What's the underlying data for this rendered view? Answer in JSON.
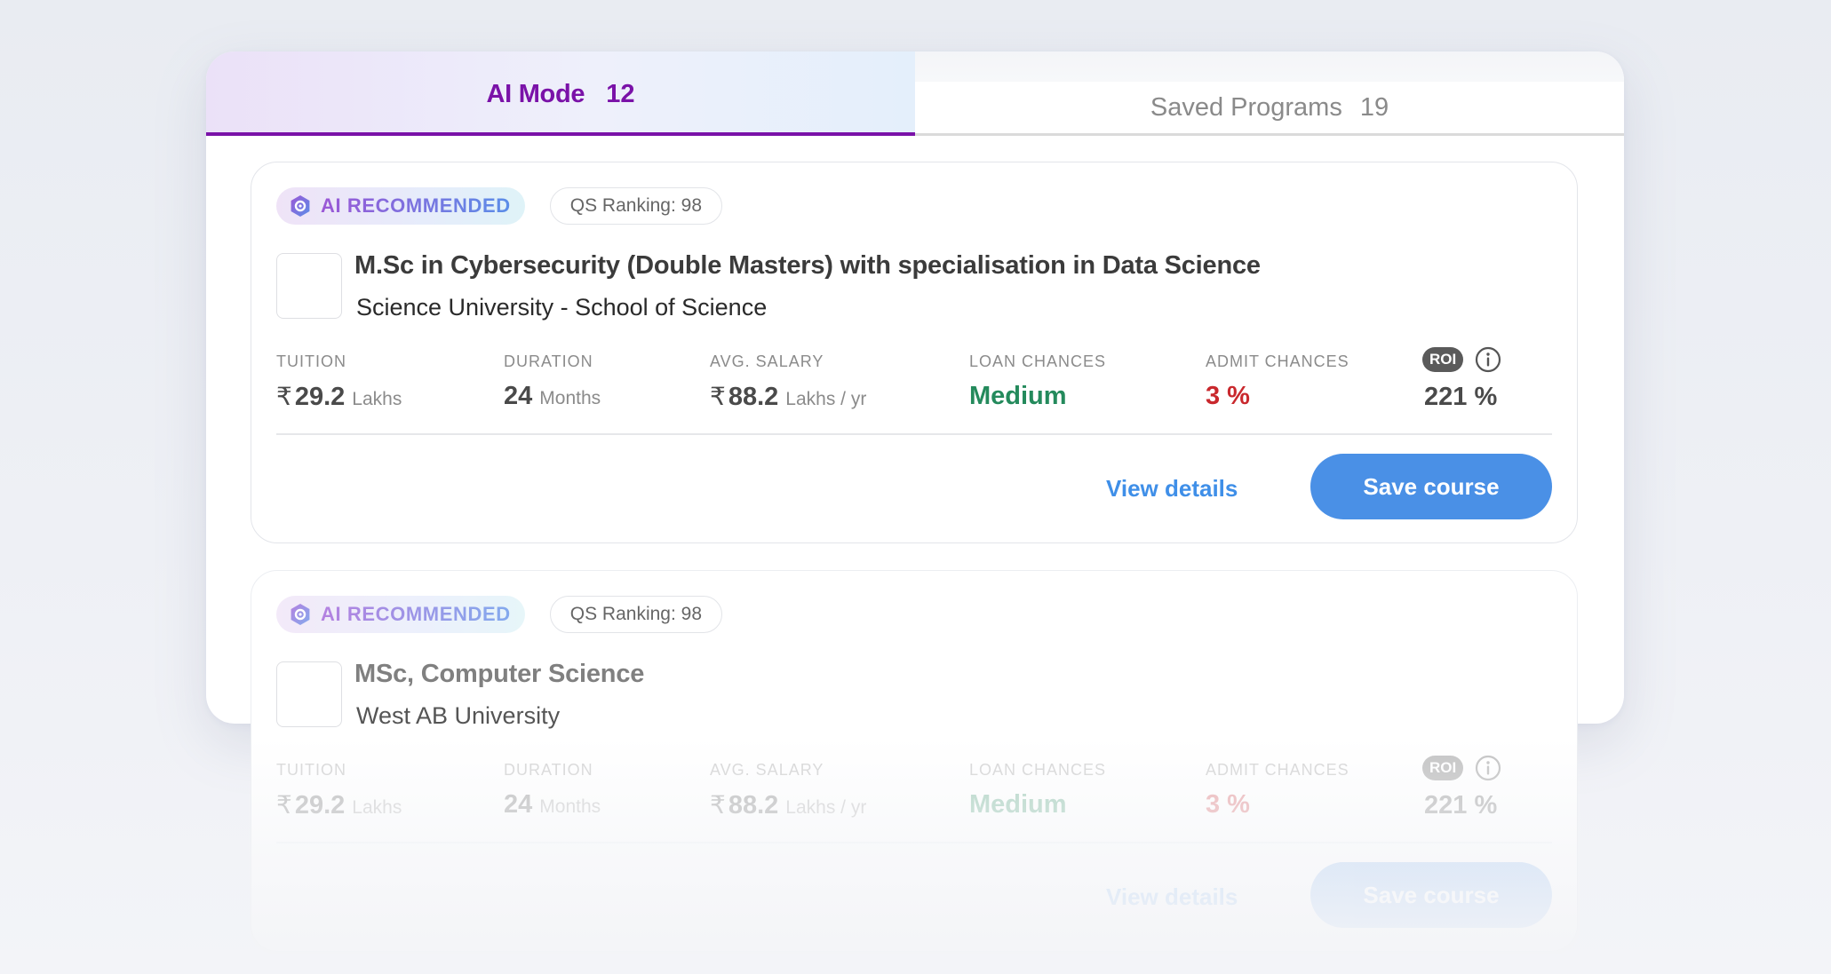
{
  "tabs": [
    {
      "label": "AI Mode",
      "count": "12"
    },
    {
      "label": "Saved Programs",
      "count": "19"
    }
  ],
  "colors": {
    "accent_purple": "#7a12a8",
    "link_blue": "#3f8fe8",
    "button_blue": "#4a90e6",
    "loan_green": "#248a5c",
    "admit_red": "#c9282d"
  },
  "icons": {
    "ai_badge": "ai-sparkle-hexagon-icon",
    "roi_info": "info-circle-icon"
  },
  "stat_labels": {
    "tuition": "TUITION",
    "duration": "DURATION",
    "salary": "AVG. SALARY",
    "loan": "LOAN CHANCES",
    "admit": "ADMIT CHANCES",
    "roi": "ROI"
  },
  "cards": [
    {
      "badge": "AI RECOMMENDED",
      "qs_ranking": "QS Ranking: 98",
      "title": "M.Sc in Cybersecurity (Double Masters) with specialisation in Data Science",
      "university": "Science University - School of Science",
      "currency": "₹",
      "tuition_value": "29.2",
      "tuition_unit": "Lakhs",
      "duration_value": "24",
      "duration_unit": "Months",
      "salary_value": "88.2",
      "salary_unit": "Lakhs / yr",
      "loan_chances": "Medium",
      "admit_chances": "3 %",
      "roi": "221 %",
      "view_details": "View details",
      "save_course": "Save course"
    },
    {
      "badge": "AI RECOMMENDED",
      "qs_ranking": "QS Ranking: 98",
      "title": "MSc, Computer Science",
      "university": "West AB University",
      "currency": "₹",
      "tuition_value": "29.2",
      "tuition_unit": "Lakhs",
      "duration_value": "24",
      "duration_unit": "Months",
      "salary_value": "88.2",
      "salary_unit": "Lakhs / yr",
      "loan_chances": "Medium",
      "admit_chances": "3 %",
      "roi": "221 %",
      "view_details": "View details",
      "save_course": "Save course"
    }
  ]
}
